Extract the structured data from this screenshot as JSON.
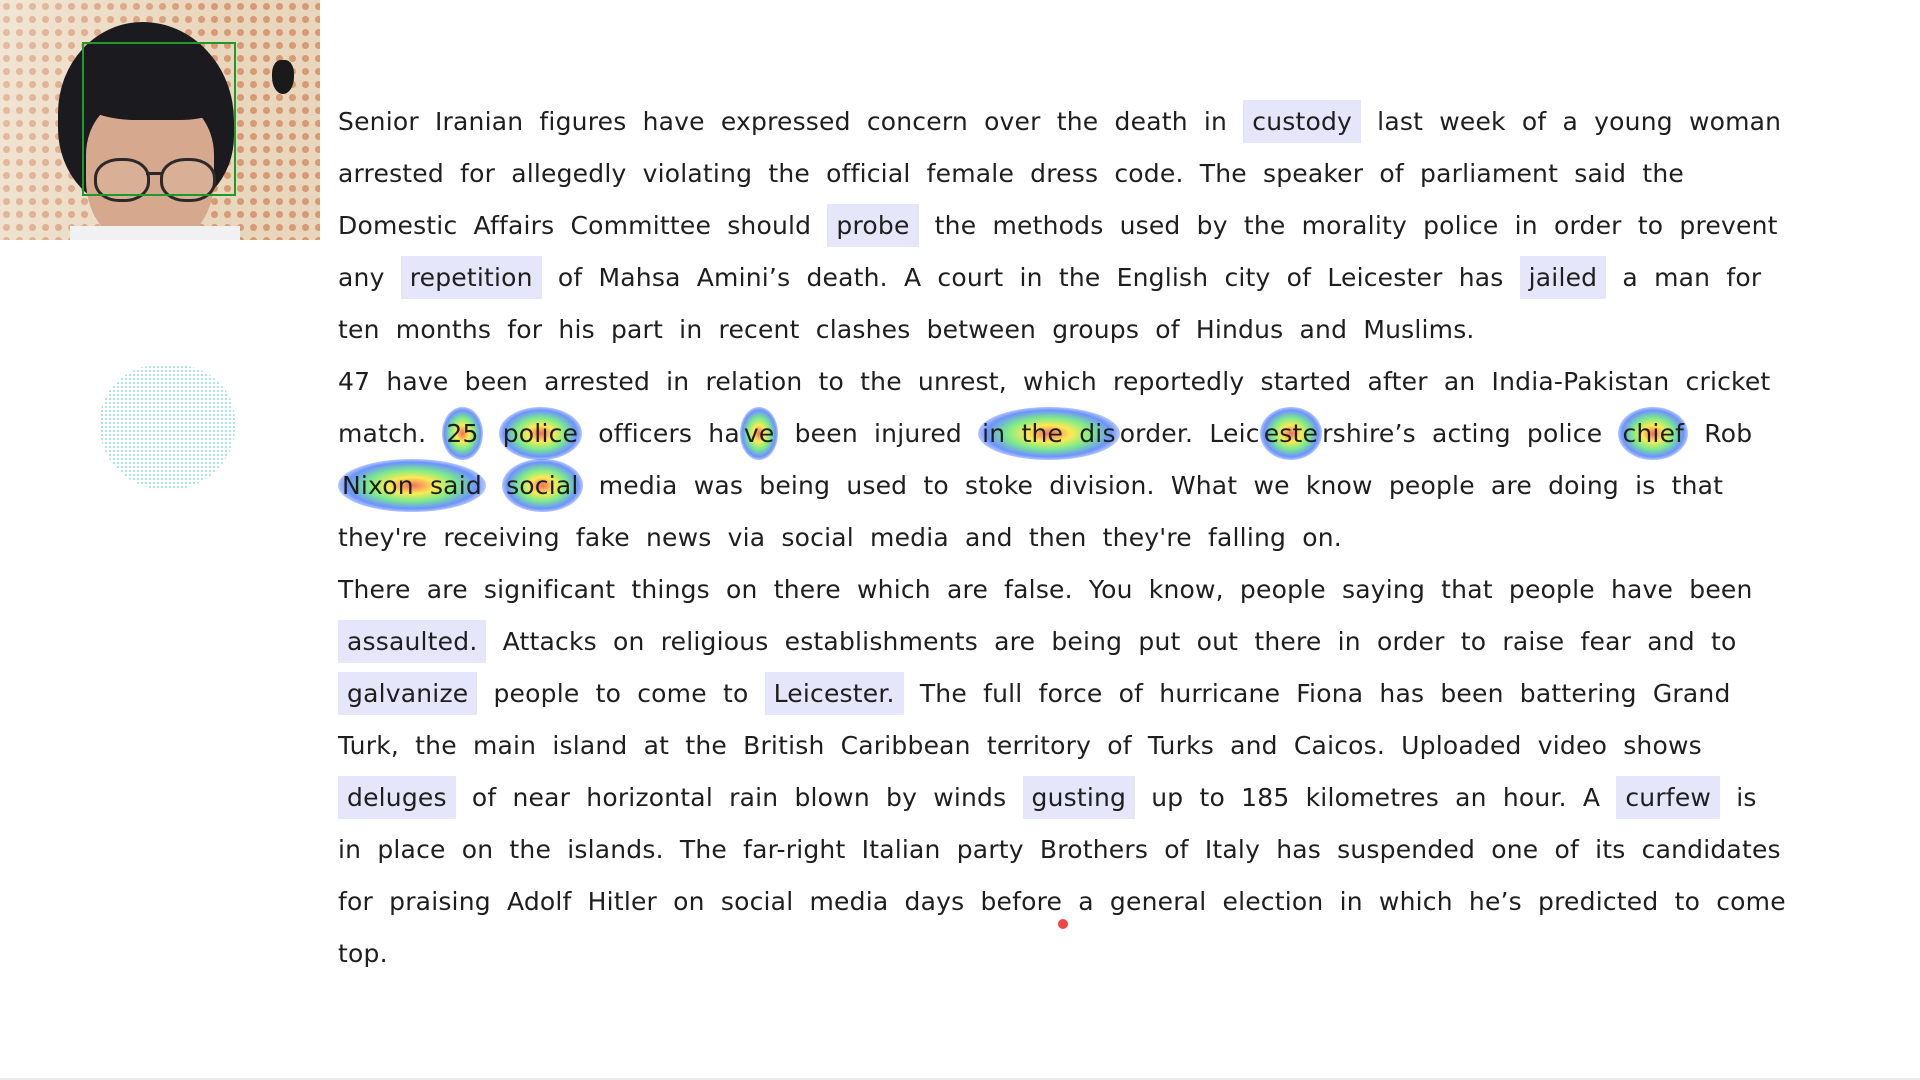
{
  "paragraphs": [
    {
      "segments": [
        {
          "text": "Senior Iranian figures have expressed concern over the death in "
        },
        {
          "text": "custody",
          "hl": true
        },
        {
          "text": " last week of a young woman arrested for allegedly violating the official female dress code. The speaker of parliament said the Domestic Affairs Committee should "
        },
        {
          "text": "probe",
          "hl": true
        },
        {
          "text": " the methods used by the morality police in order to prevent any "
        },
        {
          "text": "repetition",
          "hl": true
        },
        {
          "text": " of Mahsa Amini’s death. A court in the English city of Leicester has "
        },
        {
          "text": "jailed",
          "hl": true
        },
        {
          "text": " a man for ten months for his part in recent clashes between groups of Hindus and Muslims."
        }
      ]
    },
    {
      "segments": [
        {
          "text": "47 have been arrested in relation to the unrest, which reportedly started after an India-Pakistan cricket match. "
        },
        {
          "text": "25",
          "fix": true
        },
        {
          "text": " "
        },
        {
          "text": "police",
          "fix": true
        },
        {
          "text": " officers ha"
        },
        {
          "text": "ve",
          "fix": true
        },
        {
          "text": " been injured "
        },
        {
          "text": "in the dis",
          "fix": true
        },
        {
          "text": "order. Leic"
        },
        {
          "text": "este",
          "fix": true
        },
        {
          "text": "rshire’s acting police "
        },
        {
          "text": "chief",
          "fix": true
        },
        {
          "text": " Rob "
        },
        {
          "text": "Nixon said",
          "fix": true
        },
        {
          "text": " "
        },
        {
          "text": "social",
          "fix": true
        },
        {
          "text": " media was being used to stoke division. What we know people are doing is that they're receiving fake news via social media and then they're falling on."
        }
      ]
    },
    {
      "segments": [
        {
          "text": "There are significant things on there which are false. You know, people saying that people have been "
        },
        {
          "text": "assaulted.",
          "hl": true
        },
        {
          "text": " Attacks on religious establishments are being put out there in order to raise fear and to "
        },
        {
          "text": "galvanize",
          "hl": true
        },
        {
          "text": " people to come to "
        },
        {
          "text": "Leicester.",
          "hl": true
        },
        {
          "text": " The full force of hurricane Fiona has been battering Grand Turk, the main island at the British Caribbean territory of Turks and Caicos. Uploaded video shows "
        },
        {
          "text": "deluges",
          "hl": true
        },
        {
          "text": " of near horizontal rain blown by winds "
        },
        {
          "text": "gusting",
          "hl": true
        },
        {
          "text": " up to 185 kilometres an hour. A "
        },
        {
          "text": "curfew",
          "hl": true
        },
        {
          "text": " is in place on the islands. The far-right Italian party Brothers of Italy has suspended one of its candidates for praising Adolf Hitler on social media days before a general election in which he’s predicted to come top."
        }
      ]
    }
  ],
  "colors": {
    "highlight": "#e6e6fa",
    "gaze_dot": "#ef4444",
    "face_box": "#1e9a2a",
    "text": "#1e1e1e"
  }
}
